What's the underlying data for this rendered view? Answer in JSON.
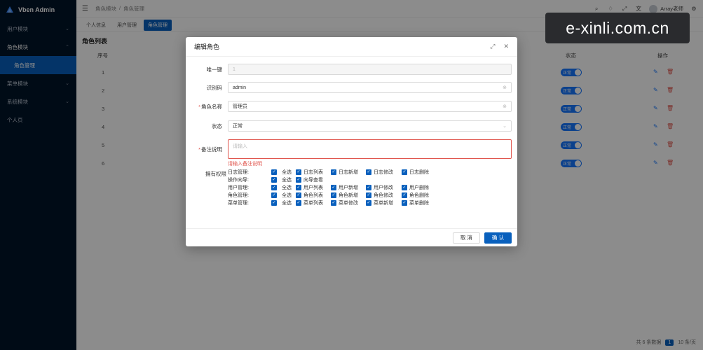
{
  "app": {
    "name": "Vben Admin"
  },
  "sidebar": {
    "items": [
      {
        "label": "用户模块"
      },
      {
        "label": "角色模块"
      },
      {
        "label": "角色管理"
      },
      {
        "label": "菜单模块"
      },
      {
        "label": "系统模块"
      },
      {
        "label": "个人页"
      }
    ]
  },
  "header": {
    "breadcrumb": [
      "角色模块",
      "/",
      "角色管理"
    ],
    "user": "Array老师"
  },
  "tabs": [
    "个人信息",
    "用户管理",
    "角色管理"
  ],
  "page": {
    "title": "角色列表",
    "columns": {
      "index": "序号",
      "status": "状态",
      "ops": "操作"
    },
    "rows": [
      "1",
      "2",
      "3",
      "4",
      "5",
      "6"
    ],
    "status_text": "正常",
    "pager": {
      "total": "共 6 条数据",
      "page": "1",
      "size": "10 条/页"
    }
  },
  "watermark": "e-xinli.com.cn",
  "modal": {
    "title": "编辑角色",
    "fields": {
      "uid_label": "唯一键",
      "uid_value": "1",
      "code_label": "识别码",
      "code_value": "admin",
      "name_label": "角色名称",
      "name_value": "管理员",
      "status_label": "状态",
      "status_value": "正常",
      "remark_label": "备注说明",
      "remark_placeholder": "请输入",
      "remark_error": "请输入备注说明"
    },
    "perm_label": "拥有权限",
    "permissions": [
      {
        "group": "日志管理:",
        "items": [
          "全选",
          "日志列表",
          "日志新增",
          "日志修改",
          "日志删除"
        ]
      },
      {
        "group": "操作向导:",
        "items": [
          "全选",
          "向导查看"
        ]
      },
      {
        "group": "用户管理:",
        "items": [
          "全选",
          "用户列表",
          "用户新增",
          "用户修改",
          "用户删除"
        ]
      },
      {
        "group": "角色管理:",
        "items": [
          "全选",
          "角色列表",
          "角色新增",
          "角色修改",
          "角色删除"
        ]
      },
      {
        "group": "菜单管理:",
        "items": [
          "全选",
          "菜单列表",
          "菜单修改",
          "菜单新增",
          "菜单删除"
        ]
      }
    ],
    "cancel": "取 消",
    "ok": "确 认"
  }
}
